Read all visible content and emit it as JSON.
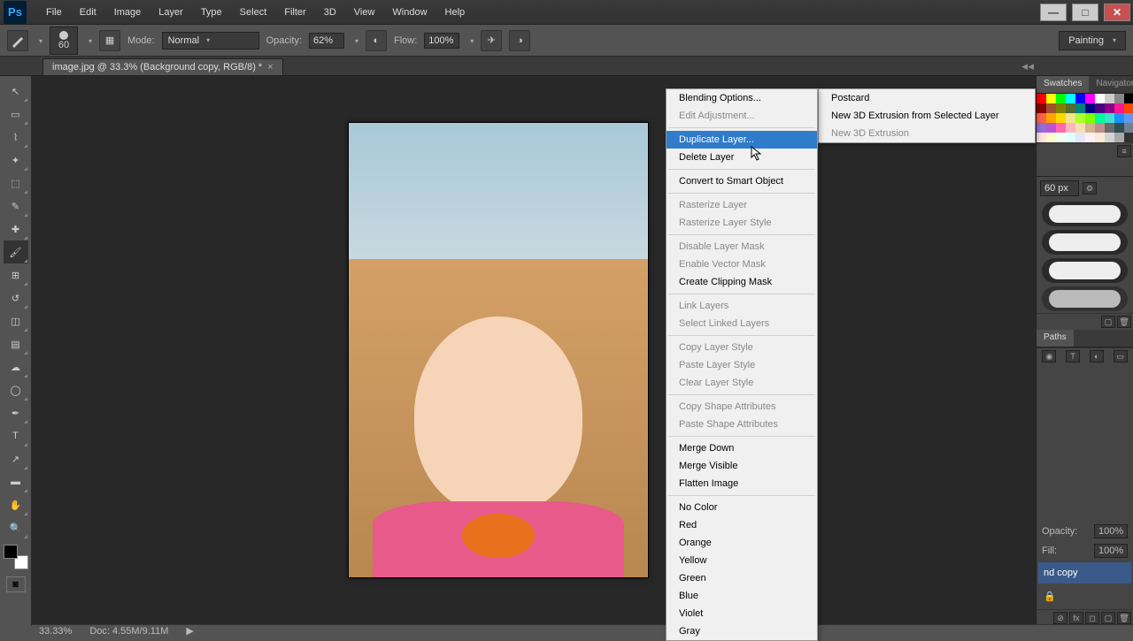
{
  "app": {
    "logo": "Ps"
  },
  "menubar": [
    "File",
    "Edit",
    "Image",
    "Layer",
    "Type",
    "Select",
    "Filter",
    "3D",
    "View",
    "Window",
    "Help"
  ],
  "win_controls": {
    "min": "—",
    "max": "□",
    "close": "✕"
  },
  "options": {
    "brush_size": "60",
    "mode_label": "Mode:",
    "mode_value": "Normal",
    "opacity_label": "Opacity:",
    "opacity_value": "62%",
    "flow_label": "Flow:",
    "flow_value": "100%",
    "workspace": "Painting"
  },
  "doc_tab": {
    "title": "image.jpg @ 33.3% (Background copy, RGB/8) *",
    "close": "×"
  },
  "status": {
    "zoom": "33.33%",
    "doc": "Doc: 4.55M/9.11M"
  },
  "panels": {
    "swatches_tab": "Swatches",
    "navigator_tab": "Navigator",
    "brush_size_value": "60 px",
    "paths_tab": "Paths",
    "opacity_label": "Opacity:",
    "opacity_value": "100%",
    "fill_label": "Fill:",
    "fill_value": "100%",
    "layer_name": "nd copy"
  },
  "context_menu": {
    "groups": [
      [
        {
          "t": "Blending Options...",
          "e": true
        },
        {
          "t": "Edit Adjustment...",
          "e": false
        }
      ],
      [
        {
          "t": "Duplicate Layer...",
          "e": true,
          "hl": true
        },
        {
          "t": "Delete Layer",
          "e": true
        }
      ],
      [
        {
          "t": "Convert to Smart Object",
          "e": true
        }
      ],
      [
        {
          "t": "Rasterize Layer",
          "e": false
        },
        {
          "t": "Rasterize Layer Style",
          "e": false
        }
      ],
      [
        {
          "t": "Disable Layer Mask",
          "e": false
        },
        {
          "t": "Enable Vector Mask",
          "e": false
        },
        {
          "t": "Create Clipping Mask",
          "e": true
        }
      ],
      [
        {
          "t": "Link Layers",
          "e": false
        },
        {
          "t": "Select Linked Layers",
          "e": false
        }
      ],
      [
        {
          "t": "Copy Layer Style",
          "e": false
        },
        {
          "t": "Paste Layer Style",
          "e": false
        },
        {
          "t": "Clear Layer Style",
          "e": false
        }
      ],
      [
        {
          "t": "Copy Shape Attributes",
          "e": false
        },
        {
          "t": "Paste Shape Attributes",
          "e": false
        }
      ],
      [
        {
          "t": "Merge Down",
          "e": true
        },
        {
          "t": "Merge Visible",
          "e": true
        },
        {
          "t": "Flatten Image",
          "e": true
        }
      ],
      [
        {
          "t": "No Color",
          "e": true
        },
        {
          "t": "Red",
          "e": true
        },
        {
          "t": "Orange",
          "e": true
        },
        {
          "t": "Yellow",
          "e": true
        },
        {
          "t": "Green",
          "e": true
        },
        {
          "t": "Blue",
          "e": true
        },
        {
          "t": "Violet",
          "e": true
        },
        {
          "t": "Gray",
          "e": true
        }
      ]
    ]
  },
  "submenu": [
    {
      "t": "Postcard",
      "e": true
    },
    {
      "t": "New 3D Extrusion from Selected Layer",
      "e": true
    },
    {
      "t": "New 3D Extrusion",
      "e": false
    }
  ],
  "swatch_colors": [
    "#ff0000",
    "#ffff00",
    "#00ff00",
    "#00ffff",
    "#0000ff",
    "#ff00ff",
    "#ffffff",
    "#cccccc",
    "#888888",
    "#000000",
    "#8b0000",
    "#a0522d",
    "#808000",
    "#556b2f",
    "#008080",
    "#000080",
    "#4b0082",
    "#8b008b",
    "#ff1493",
    "#ff4500",
    "#ff6347",
    "#ffa500",
    "#ffd700",
    "#f0e68c",
    "#adff2f",
    "#7fff00",
    "#00fa9a",
    "#40e0d0",
    "#1e90ff",
    "#6495ed",
    "#9370db",
    "#ba55d3",
    "#ff69b4",
    "#ffb6c1",
    "#f5deb3",
    "#d2b48c",
    "#bc8f8f",
    "#696969",
    "#2f4f4f",
    "#708090",
    "#ffe4e1",
    "#fffacd",
    "#f0fff0",
    "#e0ffff",
    "#e6e6fa",
    "#fff0f5",
    "#faebd7",
    "#d3d3d3",
    "#a9a9a9",
    "#333333"
  ],
  "tools": [
    "move",
    "rect-marquee",
    "lasso",
    "magic-wand",
    "crop",
    "eyedropper",
    "healing",
    "brush",
    "stamp",
    "history-brush",
    "eraser",
    "gradient",
    "blur",
    "dodge",
    "pen",
    "type",
    "path-select",
    "shape",
    "hand",
    "zoom"
  ]
}
